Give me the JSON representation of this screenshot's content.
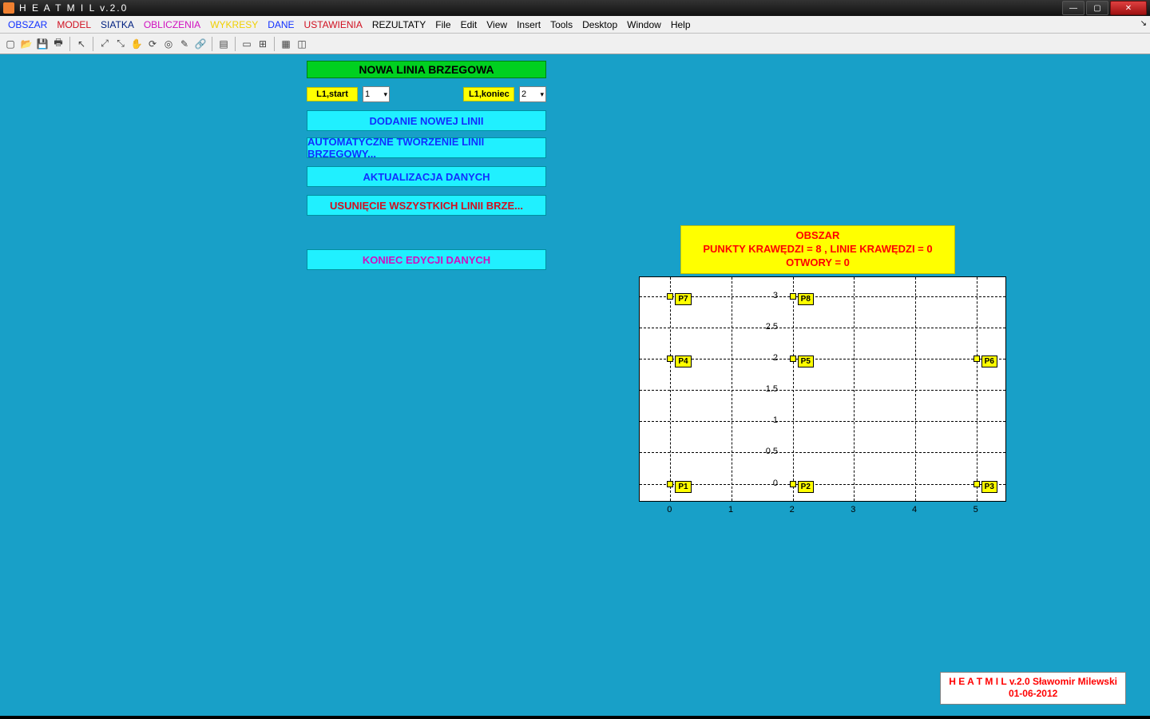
{
  "window": {
    "title": "H E A T M I L   v.2.0"
  },
  "menu": {
    "items": [
      {
        "label": "OBSZAR",
        "cls": "blue"
      },
      {
        "label": "MODEL",
        "cls": "red"
      },
      {
        "label": "SIATKA",
        "cls": "navy"
      },
      {
        "label": "OBLICZENIA",
        "cls": "magenta"
      },
      {
        "label": "WYKRESY",
        "cls": "yellow"
      },
      {
        "label": "DANE",
        "cls": "blue"
      },
      {
        "label": "USTAWIENIA",
        "cls": "red"
      },
      {
        "label": "REZULTATY",
        "cls": "black"
      },
      {
        "label": "File",
        "cls": "black"
      },
      {
        "label": "Edit",
        "cls": "black"
      },
      {
        "label": "View",
        "cls": "black"
      },
      {
        "label": "Insert",
        "cls": "black"
      },
      {
        "label": "Tools",
        "cls": "black"
      },
      {
        "label": "Desktop",
        "cls": "black"
      },
      {
        "label": "Window",
        "cls": "black"
      },
      {
        "label": "Help",
        "cls": "black"
      }
    ],
    "right_marker": "↘"
  },
  "toolbar_icons": [
    "new-doc",
    "open",
    "save",
    "print",
    "|",
    "pointer",
    "|",
    "zoom-in",
    "zoom-out",
    "pan",
    "rotate",
    "data-cursor",
    "brush",
    "link",
    "|",
    "colorbar",
    "|",
    "legend",
    "axes",
    "|",
    "grid",
    "snap"
  ],
  "panel": {
    "banner": "NOWA LINIA BRZEGOWA",
    "l1_start_label": "L1,start",
    "l1_start_value": "1",
    "l1_end_label": "L1,koniec",
    "l1_end_value": "2",
    "btn_add": "DODANIE NOWEJ LINII",
    "btn_auto": "AUTOMATYCZNE TWORZENIE LINII BRZEGOWY...",
    "btn_update": "AKTUALIZACJA DANYCH",
    "btn_delete": "USUNIĘCIE WSZYSTKICH LINII BRZE...",
    "btn_end": "KONIEC EDYCJI DANYCH"
  },
  "chart_data": {
    "type": "scatter",
    "title_line1": "OBSZAR",
    "title_line2": "PUNKTY KRAWĘDZI = 8 , LINIE KRAWĘDZI = 0",
    "title_line3": "OTWORY = 0",
    "xlim": [
      -0.5,
      5.5
    ],
    "ylim": [
      -0.3,
      3.3
    ],
    "xticks": [
      0,
      1,
      2,
      3,
      4,
      5
    ],
    "yticks": [
      0,
      0.5,
      1,
      1.5,
      2,
      2.5,
      3
    ],
    "points": [
      {
        "id": "P1",
        "x": 0,
        "y": 0
      },
      {
        "id": "P2",
        "x": 2,
        "y": 0
      },
      {
        "id": "P3",
        "x": 5,
        "y": 0
      },
      {
        "id": "P4",
        "x": 0,
        "y": 2
      },
      {
        "id": "P5",
        "x": 2,
        "y": 2
      },
      {
        "id": "P6",
        "x": 5,
        "y": 2
      },
      {
        "id": "P7",
        "x": 0,
        "y": 3
      },
      {
        "id": "P8",
        "x": 2,
        "y": 3
      }
    ]
  },
  "credit": {
    "line1": "H E A T M I L v.2.0    Sławomir Milewski",
    "line2": "01-06-2012"
  }
}
